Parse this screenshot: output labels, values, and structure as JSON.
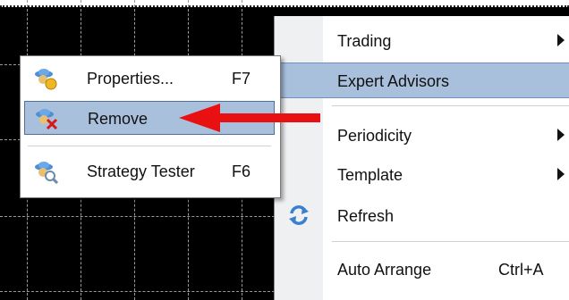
{
  "main_menu": {
    "items": [
      {
        "label": "Trading",
        "has_submenu": true
      },
      {
        "label": "Expert Advisors",
        "has_submenu": true,
        "highlighted": true
      },
      {
        "label": "Periodicity",
        "has_submenu": true
      },
      {
        "label": "Template",
        "has_submenu": true
      },
      {
        "label": "Refresh",
        "icon": "refresh-icon"
      },
      {
        "label": "Auto Arrange",
        "shortcut": "Ctrl+A"
      }
    ]
  },
  "sub_menu": {
    "items": [
      {
        "label": "Properties...",
        "shortcut": "F7",
        "icon": "expert-properties-icon"
      },
      {
        "label": "Remove",
        "icon": "expert-remove-icon",
        "highlighted": true
      },
      {
        "label": "Strategy Tester",
        "shortcut": "F6",
        "icon": "strategy-tester-icon"
      }
    ]
  },
  "colors": {
    "highlight": "#a9c0dd",
    "arrow": "#e81010",
    "chart_background": "#000000",
    "grid": "#9a9a9a"
  }
}
